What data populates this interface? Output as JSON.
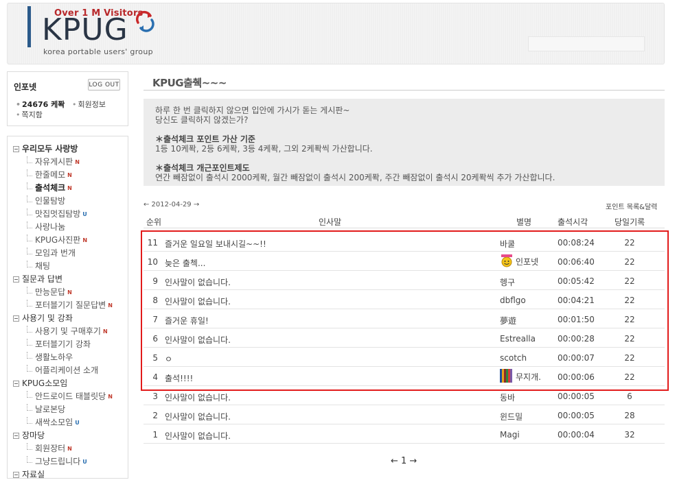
{
  "header": {
    "tagline": "Over 1 M Visitors",
    "logo": "KPUG",
    "subtitle": "korea portable users' group"
  },
  "user_box": {
    "name": "인포넷",
    "logout": "LOG OUT",
    "points": "24676 케퐉",
    "member_info": "회원정보",
    "messages": "쪽지함"
  },
  "menu": [
    {
      "type": "cat",
      "label": "우리모두 사랑방",
      "bold": true
    },
    {
      "type": "item",
      "label": "자유게시판",
      "badge": "N"
    },
    {
      "type": "item",
      "label": "한줄메모",
      "badge": "N"
    },
    {
      "type": "item",
      "label": "출석체크",
      "badge": "N",
      "bold": true
    },
    {
      "type": "item",
      "label": "인물탐방",
      "badge": ""
    },
    {
      "type": "item",
      "label": "맛집멋집탐방",
      "badge": "U"
    },
    {
      "type": "item",
      "label": "사랑나눔",
      "badge": ""
    },
    {
      "type": "item",
      "label": "KPUG사진판",
      "badge": "N"
    },
    {
      "type": "item",
      "label": "모임과 번개",
      "badge": ""
    },
    {
      "type": "item",
      "label": "채팅",
      "badge": ""
    },
    {
      "type": "cat",
      "label": "질문과 답변"
    },
    {
      "type": "item",
      "label": "만능문답",
      "badge": "N"
    },
    {
      "type": "item",
      "label": "포터블기기 질문답변",
      "badge": "N"
    },
    {
      "type": "cat",
      "label": "사용기 및 강좌"
    },
    {
      "type": "item",
      "label": "사용기 및 구매후기",
      "badge": "N"
    },
    {
      "type": "item",
      "label": "포터블기기 강좌",
      "badge": ""
    },
    {
      "type": "item",
      "label": "생활노하우",
      "badge": ""
    },
    {
      "type": "item",
      "label": "어플리케이션 소개",
      "badge": ""
    },
    {
      "type": "cat",
      "label": "KPUG소모임"
    },
    {
      "type": "item",
      "label": "안드로이드 태블릿당",
      "badge": "N"
    },
    {
      "type": "item",
      "label": "날로본당",
      "badge": ""
    },
    {
      "type": "item",
      "label": "새싹소모임",
      "badge": "U"
    },
    {
      "type": "cat",
      "label": "장마당"
    },
    {
      "type": "item",
      "label": "회원장터",
      "badge": "N"
    },
    {
      "type": "item",
      "label": "그냥드립니다",
      "badge": "U"
    },
    {
      "type": "cat",
      "label": "자료실"
    }
  ],
  "main": {
    "title": "KPUG출췍~~~",
    "info": {
      "line1": "하루 한 번 클릭하지 않으면 입안에 가시가 돋는 게시판~",
      "line2": "당신도 클릭하지 않겠는가?",
      "head1": "＊출석체크 포인트 가산 기준",
      "line3": "1등 10케퐉, 2등 6케퐉, 3등 4케퐉, 그외 2케퐉씩 가산합니다.",
      "head2": "＊출석체크 개근포인트제도",
      "line4": "연간 빼잠없이 출석시 2000케퐉, 월간 빼잠없이 출석시 200케퐉, 주간 빼잠없이 출석시 20케퐉씩 추가 가산합니다."
    },
    "date_nav": "← 2012-04-29 →",
    "points_link": "포인트 목록&달력",
    "columns": {
      "rank": "순위",
      "msg": "인사말",
      "nick": "별명",
      "time": "출석시각",
      "count": "당일기록"
    },
    "rows": [
      {
        "rank": "11",
        "msg": "즐거운 일요일 보내시길~~!!",
        "nick": "바쿨",
        "time": "00:08:24",
        "count": "22",
        "icon": ""
      },
      {
        "rank": "10",
        "msg": "늦은 출첵...",
        "nick": "인포넷",
        "time": "00:06:40",
        "count": "22",
        "icon": "smiley"
      },
      {
        "rank": "9",
        "msg": "인사말이 없습니다.",
        "nick": "헹구",
        "time": "00:05:42",
        "count": "22",
        "icon": ""
      },
      {
        "rank": "8",
        "msg": "인사말이 없습니다.",
        "nick": "dbflgo",
        "time": "00:04:21",
        "count": "22",
        "icon": ""
      },
      {
        "rank": "7",
        "msg": "즐거운 휴일!",
        "nick": "夢遊",
        "time": "00:01:50",
        "count": "22",
        "icon": ""
      },
      {
        "rank": "6",
        "msg": "인사말이 없습니다.",
        "nick": "Estrealla",
        "time": "00:00:28",
        "count": "22",
        "icon": ""
      },
      {
        "rank": "5",
        "msg": "ㅇ",
        "nick": "scotch",
        "time": "00:00:07",
        "count": "22",
        "icon": ""
      },
      {
        "rank": "4",
        "msg": "출석!!!!",
        "nick": "무지개.",
        "time": "00:00:06",
        "count": "22",
        "icon": "rainbow"
      },
      {
        "rank": "3",
        "msg": "인사말이 없습니다.",
        "nick": "동바",
        "time": "00:00:05",
        "count": "6",
        "icon": ""
      },
      {
        "rank": "2",
        "msg": "인사말이 없습니다.",
        "nick": "윈드밀",
        "time": "00:00:05",
        "count": "28",
        "icon": ""
      },
      {
        "rank": "1",
        "msg": "인사말이 없습니다.",
        "nick": "Magi",
        "time": "00:00:04",
        "count": "32",
        "icon": ""
      }
    ],
    "pager": "← 1 →"
  }
}
